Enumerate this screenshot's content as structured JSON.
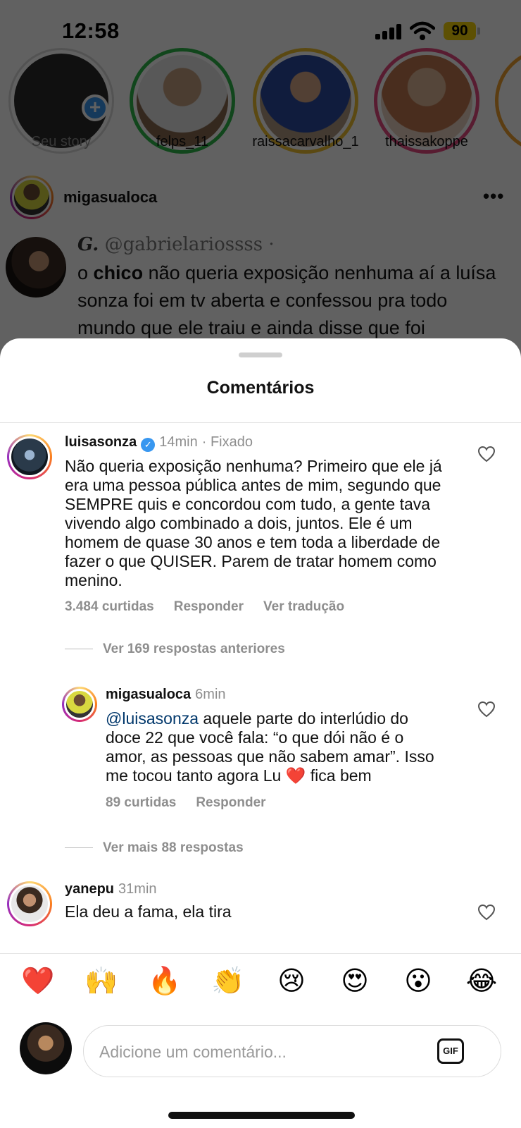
{
  "status_bar": {
    "time": "12:58",
    "battery": "90"
  },
  "stories": [
    {
      "name": "Seu story",
      "ring": "#dbdbdb",
      "own": true,
      "face": "#2b2b2b"
    },
    {
      "name": "felps_11",
      "ring": "#2fb84a",
      "face": "#b89070"
    },
    {
      "name": "raissacarvalho_1",
      "ring": "#f0c030",
      "face": "#2a4aa0"
    },
    {
      "name": "thaissakoppe",
      "ring": "#e84a80",
      "face": "#d8b090"
    }
  ],
  "post": {
    "username": "migasualoca",
    "more_icon": "more-icon",
    "tweet": {
      "display_name": "G.",
      "handle": "@gabrielariossss ·",
      "text_bold": "chico",
      "text_pre": "o",
      "text_post": "não queria exposição nenhuma aí a luísa sonza foi em tv aberta e confessou pra todo mundo que ele traiu e ainda disse que foi"
    }
  },
  "sheet": {
    "title": "Comentários",
    "comments": [
      {
        "username": "luisasonza",
        "verified": true,
        "time": "14min",
        "pinned": "· Fixado",
        "text": "Não queria exposição nenhuma? Primeiro que ele já era uma pessoa pública antes de mim, segundo que SEMPRE quis e concordou com tudo, a gente tava vivendo algo combinado a dois, juntos. Ele é um homem de quase 30 anos e tem toda a liberdade de fazer o que QUISER. Parem de tratar homem como menino.",
        "likes": "3.484 curtidas",
        "reply": "Responder",
        "translate": "Ver tradução"
      },
      {
        "view_previous": "Ver 169 respostas anteriores"
      },
      {
        "username": "migasualoca",
        "time": "6min",
        "mention": "@luisasonza",
        "text": "aquele parte do interlúdio do doce 22 que você fala: “o que dói não é o amor, as pessoas que não sabem amar”. Isso me tocou tanto agora Lu ❤️ fica bem",
        "likes": "89 curtidas",
        "reply": "Responder"
      },
      {
        "view_more": "Ver mais 88 respostas"
      },
      {
        "username": "yanepu",
        "time": "31min",
        "text": "Ela deu a fama, ela tira"
      }
    ]
  },
  "emoji_bar": [
    "❤️",
    "🙌",
    "🔥",
    "👏",
    "😢",
    "😍",
    "😮",
    "😂"
  ],
  "composer": {
    "placeholder": "Adicione um comentário...",
    "gif_label": "GIF"
  }
}
